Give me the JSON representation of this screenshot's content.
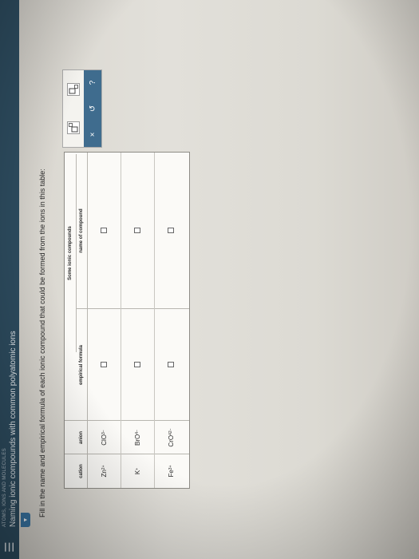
{
  "header": {
    "course": "ATOMS, IONS AND MOLECULES",
    "title": "Naming ionic compounds with common polyatomic ions"
  },
  "instructions": "Fill in the name and empirical formula of each ionic compound that could be formed from the ions in this table:",
  "table": {
    "group_header": "Some ionic compounds",
    "columns": [
      "cation",
      "anion",
      "empirical formula",
      "name of compound"
    ],
    "rows": [
      {
        "cation": "Zn",
        "cation_charge": "2+",
        "anion": "ClO",
        "anion_sub": "3",
        "anion_charge": "−"
      },
      {
        "cation": "K",
        "cation_charge": "+",
        "anion": "BrO",
        "anion_sub": "4",
        "anion_charge": "−"
      },
      {
        "cation": "Fe",
        "cation_charge": "3+",
        "anion": "CrO",
        "anion_sub": "4",
        "anion_charge": "2−"
      }
    ]
  },
  "tools": {
    "superscript_icon": "superscript-box-icon",
    "subscript_icon": "subscript-box-icon",
    "clear_label": "×",
    "undo_label": "↺",
    "help_label": "?"
  },
  "menu_label": "☰"
}
